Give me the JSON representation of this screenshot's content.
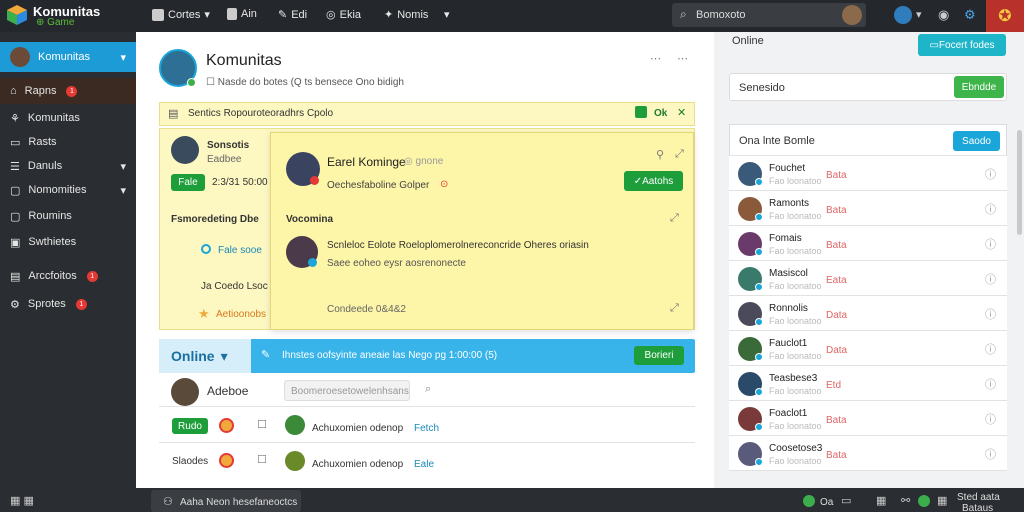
{
  "app": {
    "title": "Komunitas",
    "subtitle": "Game"
  },
  "topnav": {
    "items": [
      {
        "label": "Cortes"
      },
      {
        "label": "Ain"
      },
      {
        "label": "Edi"
      },
      {
        "label": "Ekia"
      },
      {
        "label": "Nomis"
      }
    ],
    "search_value": "Bomoxoto"
  },
  "sidebar": {
    "header_label": "Komunitas",
    "items": [
      {
        "label": "Rapns",
        "badge": "1"
      },
      {
        "label": "Komunitas",
        "badge": ""
      },
      {
        "label": "Rasts",
        "badge": ""
      },
      {
        "label": "Danuls",
        "badge": ""
      },
      {
        "label": "Nomomities",
        "badge": ""
      },
      {
        "label": "Roumins",
        "badge": ""
      },
      {
        "label": "Swthietes",
        "badge": ""
      },
      {
        "label": "Arccfoitos",
        "badge": "1"
      },
      {
        "label": "Sprotes",
        "badge": "1"
      }
    ]
  },
  "main": {
    "title": "Komunitas",
    "subtitle": "Nasde do botes (Q ts bensece Ono bidigh",
    "yellow_header": "Sentics Ropouroteoradhrs Cpolo",
    "yellow_header_count": "Ok",
    "left_card": {
      "name": "Sonsotis",
      "sub": "Eadbee",
      "button": "Fale",
      "time": "2:3/31 50:00"
    },
    "feature_label": "Fsmoredeting Dbe",
    "action_label": "Fale sooe",
    "bottom_label": "Ja Coedo Lsoc",
    "achievement": "Aetioonobs",
    "popup": {
      "name": "Earel Kominge",
      "meta": "gnone",
      "desc": "Oechesfaboline Golper",
      "button": "Aatohs",
      "section": "Vocomina",
      "post_title": "Scnleloc Eolote Roeloplomerolnereconcride Oheres oriasin",
      "post_sub": "Saee eoheo eysr aosrenonecte",
      "footer": "Condeede 0&4&2"
    },
    "online_bar": {
      "label": "Online",
      "text": "Ihnstes oofsyinte aneaie las Nego pg 1:00:00 (5)",
      "button": "Borieri"
    },
    "list_user": "Adeboe",
    "list_search_placeholder": "Boomeroesetowelenhsans",
    "list_button": "Rudo",
    "list_rows": [
      {
        "text": "Achuxomien odenop",
        "tag": "Fetch"
      },
      {
        "text": "Achuxomien odenop",
        "tag": "Eale"
      }
    ],
    "list_label_2": "Slaodes"
  },
  "right": {
    "online_label": "Online",
    "top_button": "Focert fodes",
    "search_value": "Senesido",
    "search_button": "Ebndde",
    "list_title": "Ona lnte Bomle",
    "list_button": "Saodo",
    "users": [
      {
        "name": "Fouchet",
        "sub": "Fao loonatoo",
        "tag": "Bata"
      },
      {
        "name": "Ramonts",
        "sub": "Fao loonatoo",
        "tag": "Bata"
      },
      {
        "name": "Fomais",
        "sub": "Fao loonatoo",
        "tag": "Bata"
      },
      {
        "name": "Masiscol",
        "sub": "Fao loonatoo",
        "tag": "Eata"
      },
      {
        "name": "Ronnolis",
        "sub": "Fao loonatoo",
        "tag": "Data"
      },
      {
        "name": "Fauclot1",
        "sub": "Fao loonatoo",
        "tag": "Data"
      },
      {
        "name": "Teasbese3",
        "sub": "Fao loonatoo",
        "tag": "Etd"
      },
      {
        "name": "Foaclot1",
        "sub": "Fao loonatoo",
        "tag": "Bata"
      },
      {
        "name": "Coosetose3",
        "sub": "Fao loonatoo",
        "tag": "Bata"
      }
    ]
  },
  "status": {
    "left_label": "Aaha Neon hesefaneoctcs",
    "right_count": "Oa",
    "right_text_1": "Sted aata",
    "right_text_2": "Bataus"
  },
  "colors": {
    "green": "#1e9e3a",
    "blue": "#1aa6d8",
    "yellow": "#fdf7c2",
    "dark": "#24272b",
    "red": "#e53935"
  }
}
